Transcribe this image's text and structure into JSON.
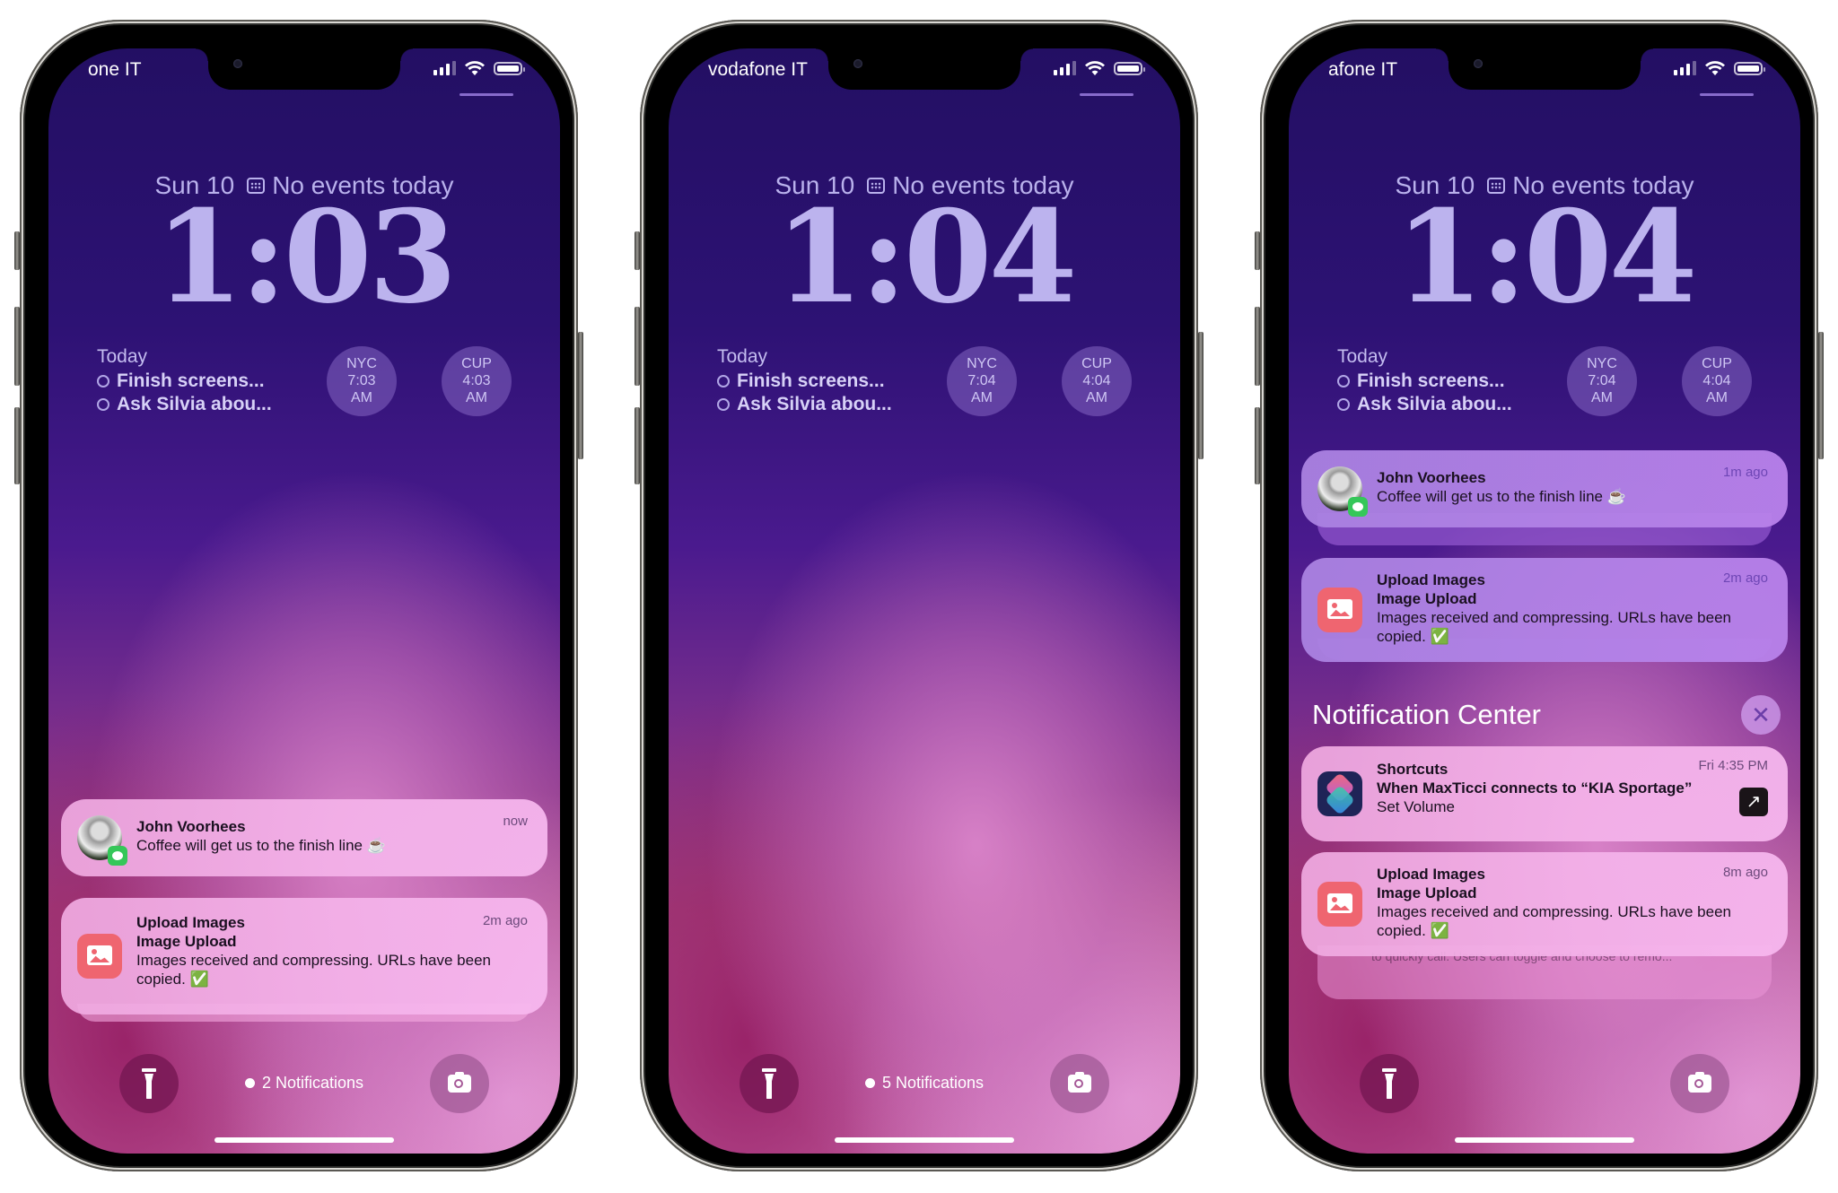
{
  "phones": [
    {
      "carrier": "one IT",
      "date": "Sun 10",
      "calendar_text": "No events today",
      "time": "1:03",
      "reminders": {
        "title": "Today",
        "items": [
          "Finish screens...",
          "Ask Silvia abou..."
        ]
      },
      "world_clocks": [
        {
          "city": "NYC",
          "time": "7:03",
          "ampm": "AM"
        },
        {
          "city": "CUP",
          "time": "4:03",
          "ampm": "AM"
        }
      ],
      "notifications": [
        {
          "sender": "John Voorhees",
          "message": "Coffee will get us to the finish line ☕",
          "time": "now"
        },
        {
          "app": "Upload Images",
          "title": "Image Upload",
          "message": "Images received and compressing. URLs have been copied. ✅",
          "time": "2m ago"
        }
      ],
      "notification_count": "2 Notifications"
    },
    {
      "carrier": "vodafone IT",
      "date": "Sun 10",
      "calendar_text": "No events today",
      "time": "1:04",
      "reminders": {
        "title": "Today",
        "items": [
          "Finish screens...",
          "Ask Silvia abou..."
        ]
      },
      "world_clocks": [
        {
          "city": "NYC",
          "time": "7:04",
          "ampm": "AM"
        },
        {
          "city": "CUP",
          "time": "4:04",
          "ampm": "AM"
        }
      ],
      "notification_count": "5 Notifications"
    },
    {
      "carrier": "afone IT",
      "date": "Sun 10",
      "calendar_text": "No events today",
      "time": "1:04",
      "reminders": {
        "title": "Today",
        "items": [
          "Finish screens...",
          "Ask Silvia abou..."
        ]
      },
      "world_clocks": [
        {
          "city": "NYC",
          "time": "7:04",
          "ampm": "AM"
        },
        {
          "city": "CUP",
          "time": "4:04",
          "ampm": "AM"
        }
      ],
      "notifications": [
        {
          "sender": "John Voorhees",
          "message": "Coffee will get us to the finish line ☕",
          "time": "1m ago"
        },
        {
          "app": "Upload Images",
          "title": "Image Upload",
          "message": "Images received and compressing. URLs have been copied. ✅",
          "time": "2m ago"
        }
      ],
      "notification_center": {
        "title": "Notification Center",
        "close_label": "✕",
        "items": [
          {
            "app": "Shortcuts",
            "title": "When MaxTicci connects to “KIA Sportage”",
            "message": "Set Volume",
            "time": "Fri 4:35 PM",
            "action_icon": "↗"
          },
          {
            "app": "Upload Images",
            "title": "Image Upload",
            "message": "Images received and compressing. URLs have been copied. ✅",
            "time": "8m ago"
          }
        ],
        "stacked_preview": "to quickly call. Users can toggle and choose to remo..."
      }
    }
  ],
  "icons": {
    "flashlight": "flashlight-icon",
    "camera": "camera-icon",
    "calendar": "calendar-icon",
    "messages": "messages-icon",
    "photos": "photo-icon",
    "shortcuts": "shortcuts-icon"
  },
  "colors": {
    "clock_text": "#bcb3ee",
    "wallpaper_top": "#230f63",
    "wallpaper_bottom": "#c866a8",
    "photos_app": "#ef6570",
    "messages_badge": "#35c759",
    "shortcuts_bg": "#1f2457"
  }
}
